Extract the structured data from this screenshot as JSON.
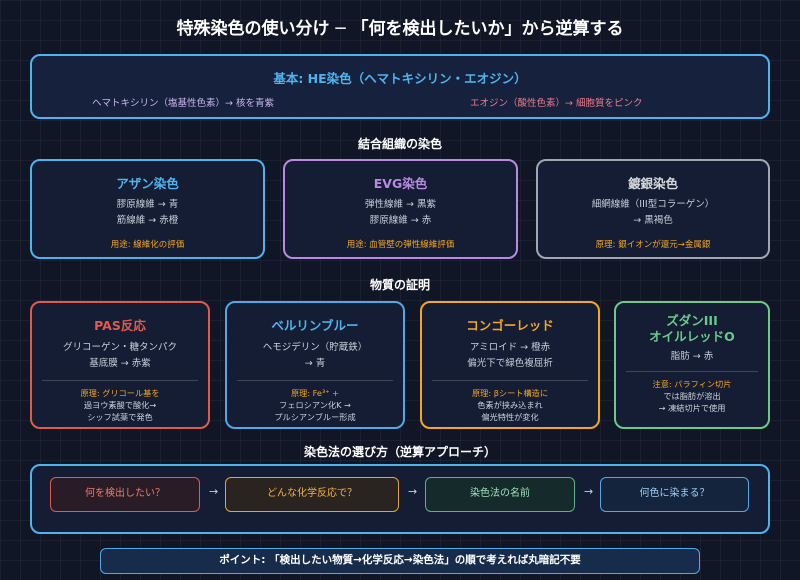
{
  "title": "特殊染色の使い分け ─ 「何を検出したいか」から逆算する",
  "he": {
    "title": "基本: HE染色（ヘマトキシリン・エオジン）",
    "left": "ヘマトキシリン（塩基性色素）→ 核を青紫",
    "right": "エオジン（酸性色素）→ 細胞質をピンク"
  },
  "sections": {
    "connective": "結合組織の染色",
    "substance": "物質の証明",
    "method": "染色法の選び方（逆算アプローチ）"
  },
  "connective_boxes": [
    {
      "title": "アザン染色",
      "line1": "膠原線維 → 青",
      "line2": "筋線維 → 赤橙",
      "note": "用途: 線維化の評価"
    },
    {
      "title": "EVG染色",
      "line1": "弾性線維 → 黒紫",
      "line2": "膠原線維 → 赤",
      "note": "用途: 血管壁の弾性線維評価"
    },
    {
      "title": "鍍銀染色",
      "line1": "細網線維（III型コラーゲン）",
      "line2": "→ 黒褐色",
      "note": "原理: 銀イオンが還元→金属銀"
    }
  ],
  "substance_boxes": [
    {
      "title": "PAS反応",
      "line1": "グリコーゲン・糖タンパク",
      "line2": "基底膜 → 赤紫",
      "note1": "原理: グリコール基を",
      "note2": "過ヨウ素酸で酸化→",
      "note3": "シッフ試薬で発色"
    },
    {
      "title": "ベルリンブルー",
      "line1": "ヘモジデリン（貯蔵鉄）",
      "line2": "→ 青",
      "note1": "原理: Fe³⁺ +",
      "note2": "フェロシアン化K →",
      "note3": "プルシアンブルー形成"
    },
    {
      "title": "コンゴーレッド",
      "line1": "アミロイド → 橙赤",
      "line2": "偏光下で緑色複屈折",
      "note1": "原理: βシート構造に",
      "note2": "色素が挟み込まれ",
      "note3": "偏光特性が変化"
    },
    {
      "title": "ズダンIII",
      "title2": "オイルレッドO",
      "line1": "脂肪 → 赤",
      "note1": "注意: パラフィン切片",
      "note2": "では脂肪が溶出",
      "note3": "→ 凍結切片で使用"
    }
  ],
  "flow": [
    "何を検出したい？",
    "どんな化学反応で？",
    "染色法の名前",
    "何色に染まる？"
  ],
  "arrow": "→",
  "point": "ポイント: 「検出したい物質→化学反応→染色法」の順で考えれば丸暗記不要",
  "colors": {
    "he": "#4fb3ee",
    "azan": "#4fb3ee",
    "evg": "#b98be0",
    "silver": "#a0a7b3",
    "pas": "#e05a4e",
    "berlin": "#4fa8e8",
    "congo": "#f5a623",
    "sudan": "#6cc98a",
    "note": "#f5a623",
    "flow_red": "#e05a4e",
    "flow_orange": "#e8a23a",
    "flow_green": "#52b58a",
    "flow_blue": "#4fa8e8"
  }
}
